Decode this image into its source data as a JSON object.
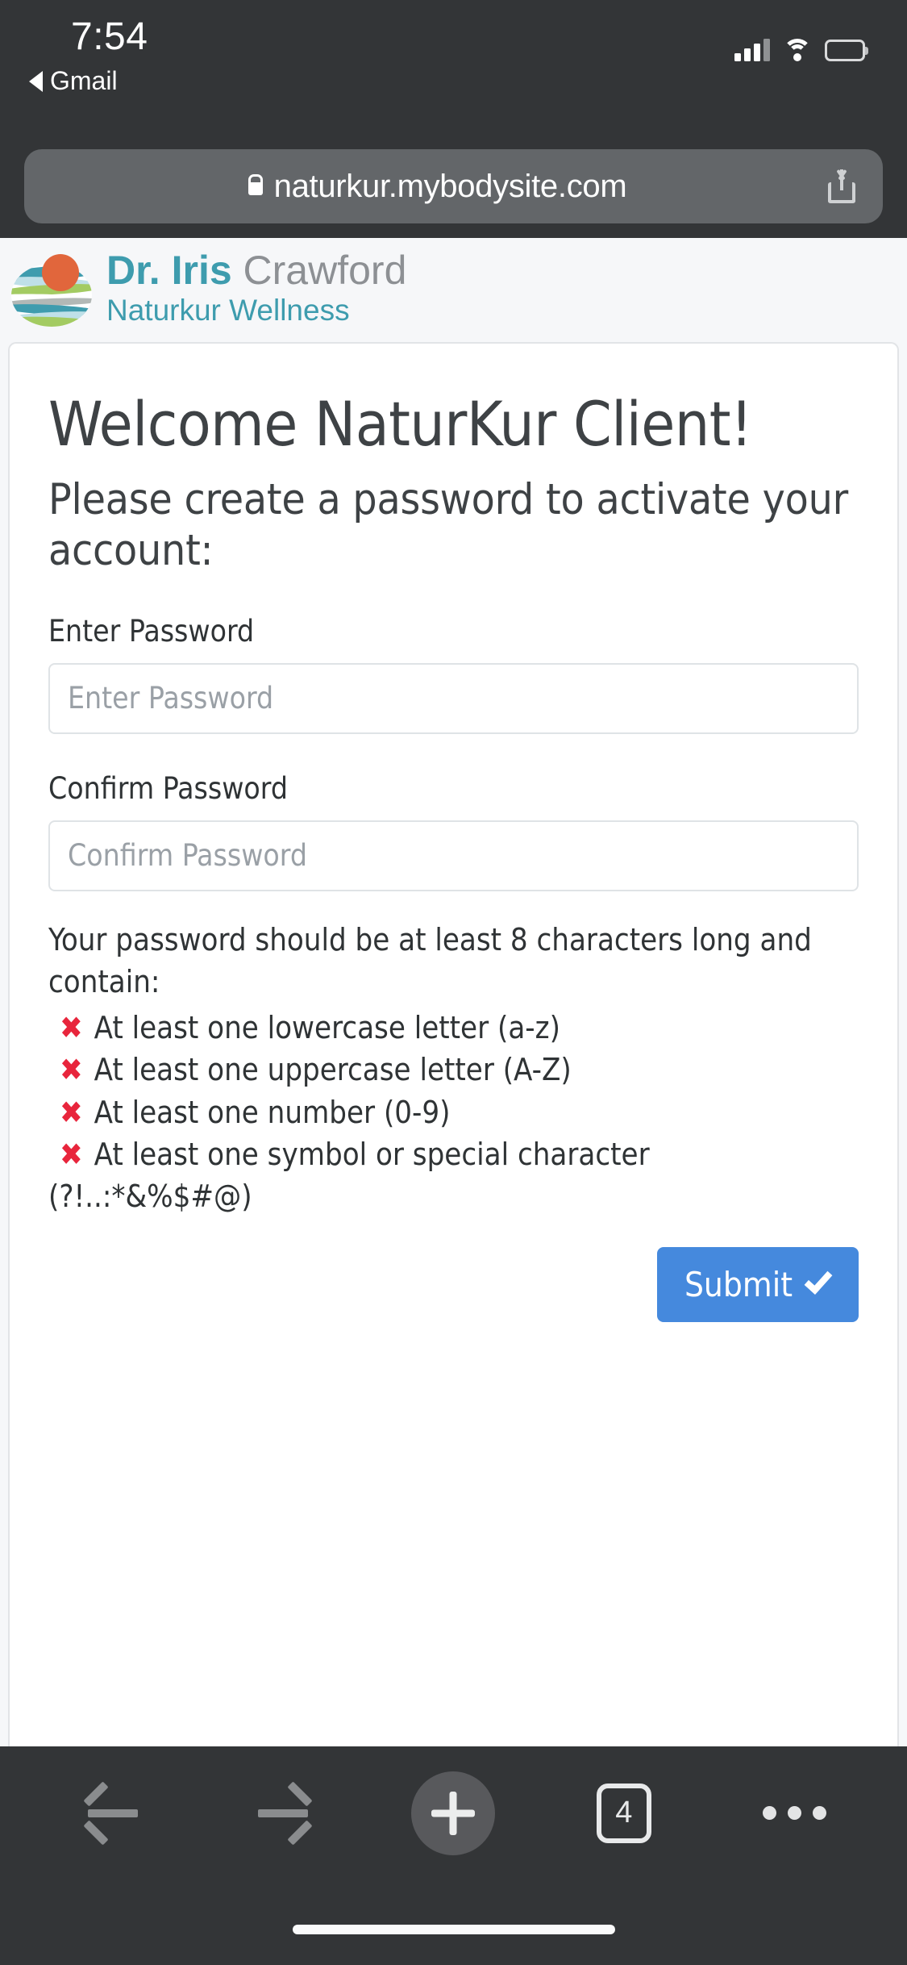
{
  "status_bar": {
    "time": "7:54",
    "back_app_label": "Gmail",
    "icons": {
      "back_arrow": "back-triangle-icon",
      "signal": "cellular-signal-icon",
      "wifi": "wifi-icon",
      "battery": "battery-icon"
    }
  },
  "browser": {
    "url": "naturkur.mybodysite.com",
    "lock_icon": "lock-icon",
    "share_icon": "share-icon",
    "toolbar": {
      "back_icon": "arrow-left-icon",
      "forward_icon": "arrow-right-icon",
      "new_tab_icon": "plus-icon",
      "tab_count": "4",
      "more_icon": "ellipsis-icon"
    }
  },
  "site_header": {
    "logo_icon": "naturkur-landscape-logo-icon",
    "name_bold": "Dr. Iris",
    "name_light": "Crawford",
    "tagline": "Naturkur Wellness"
  },
  "main": {
    "title": "Welcome NaturKur Client!",
    "subtitle": "Please create a password to activate your account:",
    "fields": [
      {
        "label": "Enter Password",
        "placeholder": "Enter Password",
        "value": ""
      },
      {
        "label": "Confirm Password",
        "placeholder": "Confirm Password",
        "value": ""
      }
    ],
    "requirements_intro": "Your password should be at least 8 characters long and contain:",
    "requirements": [
      {
        "mark": "✖",
        "text": "At least one lowercase letter (a-z)",
        "met": false
      },
      {
        "mark": "✖",
        "text": "At least one uppercase letter (A-Z)",
        "met": false
      },
      {
        "mark": "✖",
        "text": "At least one number (0-9)",
        "met": false
      },
      {
        "mark": "✖",
        "text": "At least one symbol or special character (?!..:*&%$#@)",
        "met": false
      }
    ],
    "submit_label": "Submit",
    "submit_icon": "check-icon"
  },
  "colors": {
    "brand_teal": "#3e9cae",
    "brand_orange": "#e1663c",
    "brand_green": "#a3cb62",
    "submit_blue": "#4589dd",
    "error_red": "#e8253c",
    "chrome_dark": "#333537",
    "page_bg": "#f6f7f9"
  }
}
